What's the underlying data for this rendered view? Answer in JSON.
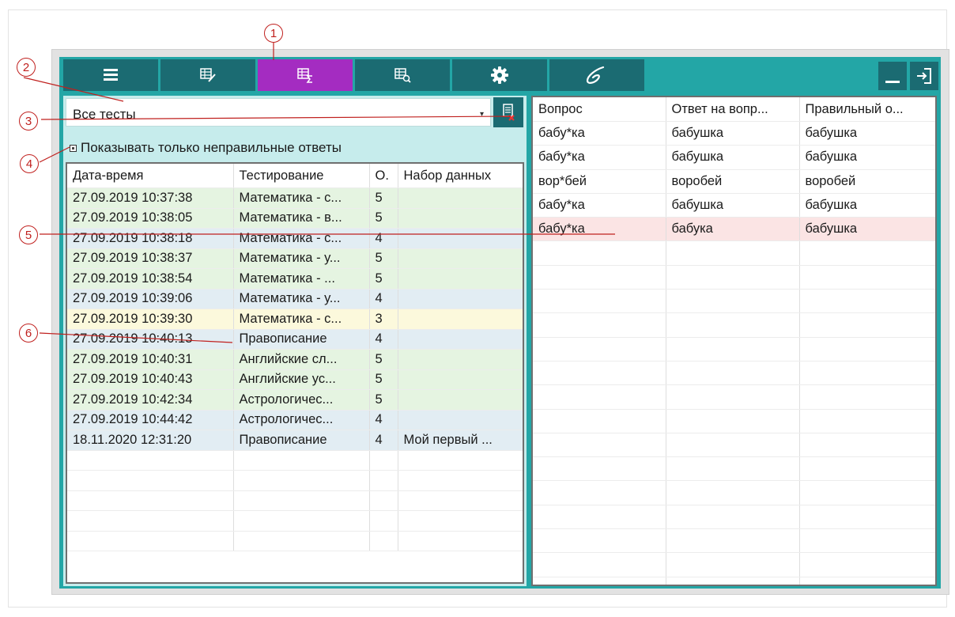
{
  "toolbar": {
    "buttons": [
      {
        "icon": "list-icon",
        "active": false
      },
      {
        "icon": "table-edit-icon",
        "active": false
      },
      {
        "icon": "table-sum-icon",
        "active": true
      },
      {
        "icon": "table-search-icon",
        "active": false
      },
      {
        "icon": "gear-icon",
        "active": false
      },
      {
        "icon": "signature-icon",
        "active": false
      }
    ],
    "window_buttons": [
      "minimize-icon",
      "exit-icon"
    ]
  },
  "filter": {
    "selected": "Все тесты",
    "clear_button_icon": "clear-filter-icon"
  },
  "show_wrong_only": {
    "label": "Показывать только неправильные ответы",
    "checked": false
  },
  "results_table": {
    "headers": [
      "Дата-время",
      "Тестирование",
      "О.",
      "Набор данных"
    ],
    "rows": [
      {
        "datetime": "27.09.2019 10:37:38",
        "test": "Математика - с...",
        "score": "5",
        "dataset": "",
        "tint": "green"
      },
      {
        "datetime": "27.09.2019 10:38:05",
        "test": "Математика - в...",
        "score": "5",
        "dataset": "",
        "tint": "green"
      },
      {
        "datetime": "27.09.2019 10:38:18",
        "test": "Математика - с...",
        "score": "4",
        "dataset": "",
        "tint": "blue"
      },
      {
        "datetime": "27.09.2019 10:38:37",
        "test": "Математика - у...",
        "score": "5",
        "dataset": "",
        "tint": "green"
      },
      {
        "datetime": "27.09.2019 10:38:54",
        "test": "Математика - ...",
        "score": "5",
        "dataset": "",
        "tint": "green"
      },
      {
        "datetime": "27.09.2019 10:39:06",
        "test": "Математика - у...",
        "score": "4",
        "dataset": "",
        "tint": "blue"
      },
      {
        "datetime": "27.09.2019 10:39:30",
        "test": "Математика - с...",
        "score": "3",
        "dataset": "",
        "tint": "yellow"
      },
      {
        "datetime": "27.09.2019 10:40:13",
        "test": "Правописание",
        "score": "4",
        "dataset": "",
        "tint": "blue"
      },
      {
        "datetime": "27.09.2019 10:40:31",
        "test": "Английские сл...",
        "score": "5",
        "dataset": "",
        "tint": "green"
      },
      {
        "datetime": "27.09.2019 10:40:43",
        "test": "Английские ус...",
        "score": "5",
        "dataset": "",
        "tint": "green"
      },
      {
        "datetime": "27.09.2019 10:42:34",
        "test": "Астрологичес...",
        "score": "5",
        "dataset": "",
        "tint": "green"
      },
      {
        "datetime": "27.09.2019 10:44:42",
        "test": "Астрологичес...",
        "score": "4",
        "dataset": "",
        "tint": "blue"
      },
      {
        "datetime": "18.11.2020 12:31:20",
        "test": "Правописание",
        "score": "4",
        "dataset": "Мой первый ...",
        "tint": "blue"
      }
    ]
  },
  "answers_table": {
    "headers": [
      "Вопрос",
      "Ответ на вопр...",
      "Правильный о..."
    ],
    "rows": [
      {
        "question": "бабу*ка",
        "answer": "бабушка",
        "correct": "бабушка",
        "tint": "white"
      },
      {
        "question": "бабу*ка",
        "answer": "бабушка",
        "correct": "бабушка",
        "tint": "white"
      },
      {
        "question": "вор*бей",
        "answer": "воробей",
        "correct": "воробей",
        "tint": "white"
      },
      {
        "question": "бабу*ка",
        "answer": "бабушка",
        "correct": "бабушка",
        "tint": "white"
      },
      {
        "question": "бабу*ка",
        "answer": "бабука",
        "correct": "бабушка",
        "tint": "pink"
      }
    ]
  },
  "callouts": [
    "1",
    "2",
    "3",
    "4",
    "5",
    "6"
  ],
  "colors": {
    "app_teal": "#23a6a6",
    "toolbar_button": "#1b6b72",
    "active_button": "#a42cc1",
    "annotation_red": "#c0201e",
    "row_green": "#e5f4e1",
    "row_blue": "#e2edf3",
    "row_yellow": "#fcf9dc",
    "row_pink": "#fbe4e4"
  }
}
